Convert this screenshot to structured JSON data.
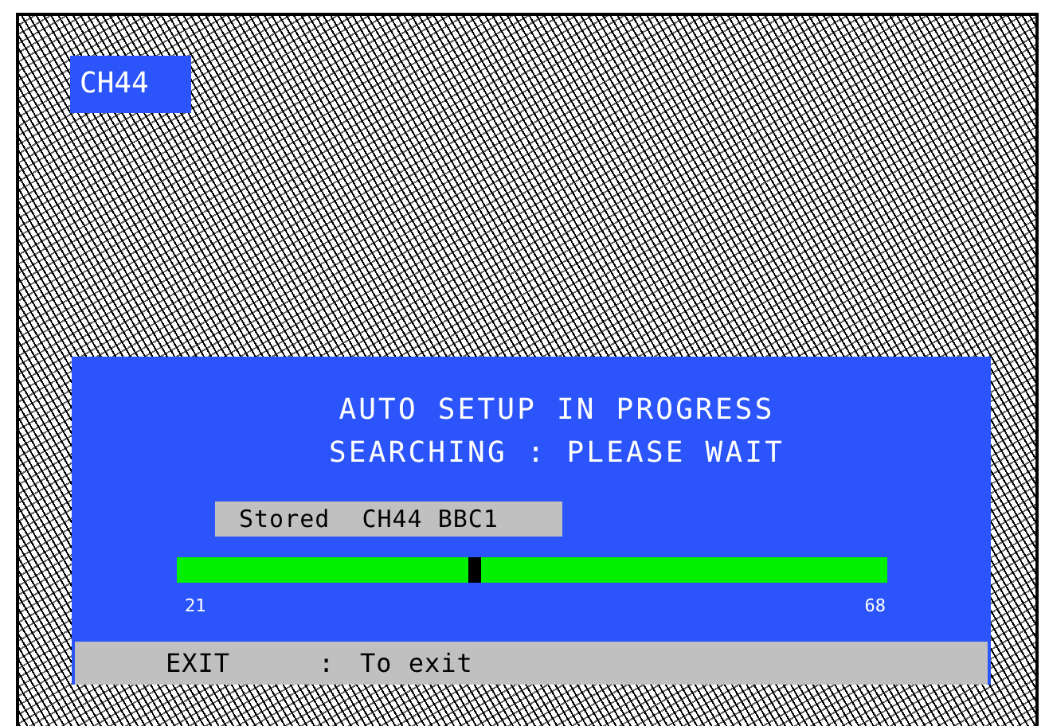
{
  "channel_badge": "CH44",
  "setup_panel": {
    "title_lines": [
      "AUTO SETUP IN PROGRESS",
      "SEARCHING : PLEASE WAIT"
    ],
    "status": {
      "label": "Stored",
      "value": "CH44 BBC1"
    },
    "scan_bar": {
      "level": 0.42,
      "min_label": "21",
      "max_label": "68"
    },
    "footer": {
      "key": "EXIT",
      "separator": ":",
      "action": "To exit"
    }
  }
}
